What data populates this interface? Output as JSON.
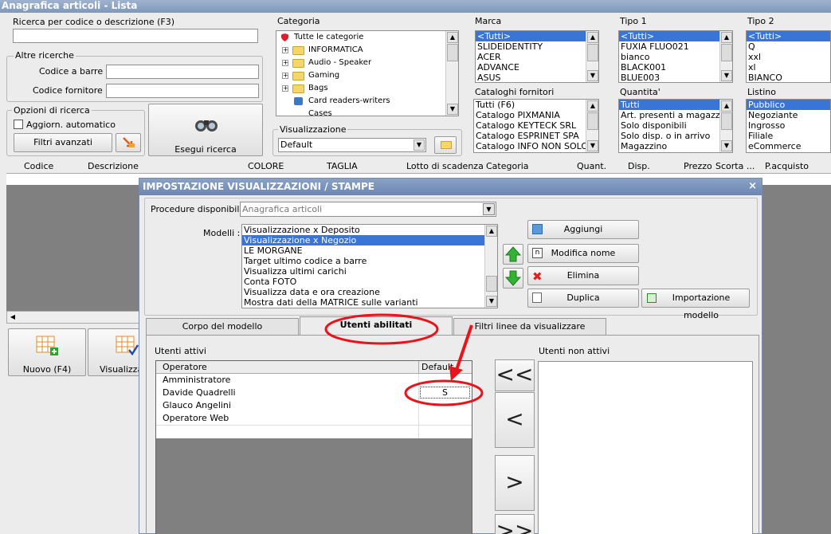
{
  "window": {
    "title": "Anagrafica articoli  - Lista"
  },
  "search": {
    "label": "Ricerca per codice o descrizione (F3)",
    "value": ""
  },
  "altre": {
    "label": "Altre ricerche",
    "barcode_label": "Codice a barre :",
    "supplier_label": "Codice fornitore :"
  },
  "options": {
    "label": "Opzioni di ricerca",
    "auto_update": "Aggiorn. automatico",
    "advanced_filters": "Filtri avanzati",
    "execute": "Esegui ricerca"
  },
  "categoria": {
    "label": "Categoria",
    "items": [
      "Tutte le categorie",
      "INFORMATICA",
      "Audio - Speaker",
      "Gaming",
      "Bags",
      "Card readers-writers",
      "Cases"
    ]
  },
  "visualizzazione": {
    "label": "Visualizzazione",
    "value": "Default"
  },
  "marca": {
    "label": "Marca",
    "items": [
      "<Tutti>",
      "SLIDEIDENTITY",
      "ACER",
      "ADVANCE",
      "ASUS"
    ]
  },
  "cataloghi": {
    "label": "Cataloghi fornitori",
    "items": [
      "Tutti (F6)",
      "Catalogo PIXMANIA",
      "Catalogo KEYTECK SRL",
      "Catalogo ESPRINET SPA",
      "Catalogo INFO NON SOLO"
    ]
  },
  "tipo1": {
    "label": "Tipo 1",
    "items": [
      "<Tutti>",
      "FUXIA FLUO021",
      "bianco",
      "BLACK001",
      "BLUE003"
    ]
  },
  "quantita": {
    "label": "Quantita'",
    "items": [
      "Tutti",
      "Art. presenti a magazzino",
      "Solo disponibili",
      "Solo disp. o in arrivo",
      "Magazzino"
    ]
  },
  "tipo2": {
    "label": "Tipo 2",
    "items": [
      "<Tutti>",
      "Q",
      "xxl",
      "xl",
      "BIANCO"
    ]
  },
  "listino": {
    "label": "Listino",
    "items": [
      "Pubblico",
      "Negoziante",
      "Ingrosso",
      "Filiale",
      "eCommerce"
    ]
  },
  "grid": {
    "columns": [
      "Codice",
      "Descrizione",
      "COLORE",
      "TAGLIA",
      "Lotto di scadenza",
      "Categoria",
      "Quant.",
      "Disp.",
      "Prezzo",
      "Scorta ...",
      "P.acquisto"
    ]
  },
  "bottom": {
    "new_label": "Nuovo (F4)",
    "view_label": "Visualizza"
  },
  "dialog": {
    "title": "IMPOSTAZIONE VISUALIZZAZIONI / STAMPE",
    "close": "×",
    "procedure_label": "Procedure disponibili :",
    "procedure_value": "Anagrafica articoli",
    "models_label": "Modelli :",
    "models": [
      "Visualizzazione x Deposito",
      "Visualizzazione x Negozio",
      "LE MORGANE",
      "Target ultimo codice a barre",
      "Visualizza ultimi carichi",
      "Conta FOTO",
      "Visualizza data e ora creazione",
      "Mostra dati della MATRICE sulle varianti"
    ],
    "add": "Aggiungi",
    "rename": "Modifica nome",
    "delete": "Elimina",
    "duplicate": "Duplica",
    "import": "Importazione modello",
    "tabs": [
      "Corpo del modello",
      "Utenti abilitati",
      "Filtri linee da visualizzare"
    ],
    "active_label": "Utenti attivi",
    "inactive_label": "Utenti non attivi",
    "table_cols": [
      "Operatore",
      "Default"
    ],
    "users": [
      {
        "name": "Amministratore",
        "default": ""
      },
      {
        "name": "Davide Quadrelli",
        "default": "S"
      },
      {
        "name": "Glauco Angelini",
        "default": ""
      },
      {
        "name": "Operatore Web",
        "default": ""
      }
    ],
    "move_all_left": "<<",
    "move_left": "<",
    "move_right": ">",
    "move_all_right": ">>"
  },
  "colors": {
    "annotation": "#e8141b",
    "selection": "#3875d7"
  }
}
